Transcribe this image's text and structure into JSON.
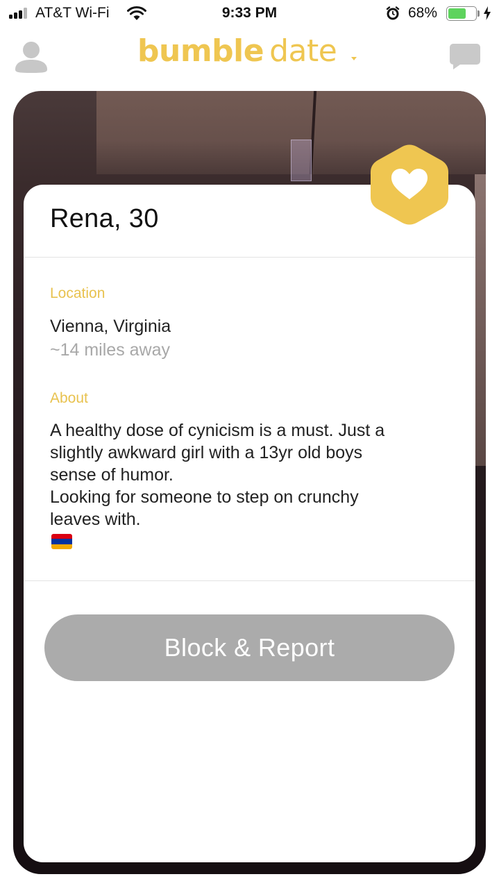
{
  "status_bar": {
    "carrier": "AT&T Wi-Fi",
    "time": "9:33 PM",
    "battery_percent": "68%",
    "battery_level": 0.68,
    "signal_bars": 3,
    "icons": [
      "signal-icon",
      "wifi-icon",
      "alarm-icon",
      "battery-icon",
      "charging-bolt-icon"
    ]
  },
  "header": {
    "logo_primary": "bumble",
    "logo_secondary": "date",
    "icons": [
      "profile-icon",
      "mode-dropdown-caret-icon",
      "chat-icon"
    ],
    "accent_color": "#efc651"
  },
  "profile": {
    "name_age": "Rena, 30",
    "badge_icon": "heart-icon",
    "location": {
      "label": "Location",
      "city": "Vienna, Virginia",
      "distance": "~14 miles away"
    },
    "about": {
      "label": "About",
      "lines": [
        "A healthy dose of cynicism is a must. Just a",
        "slightly awkward girl with a 13yr old boys",
        "sense of humor.",
        "Looking for someone to step on crunchy",
        "leaves with."
      ],
      "flag_emoji": "armenia-flag"
    }
  },
  "actions": {
    "block_report_label": "Block & Report"
  },
  "colors": {
    "accent": "#efc651",
    "section_label": "#e8c24f",
    "button_gray": "#ababab",
    "muted_text": "#a8a8a8"
  }
}
